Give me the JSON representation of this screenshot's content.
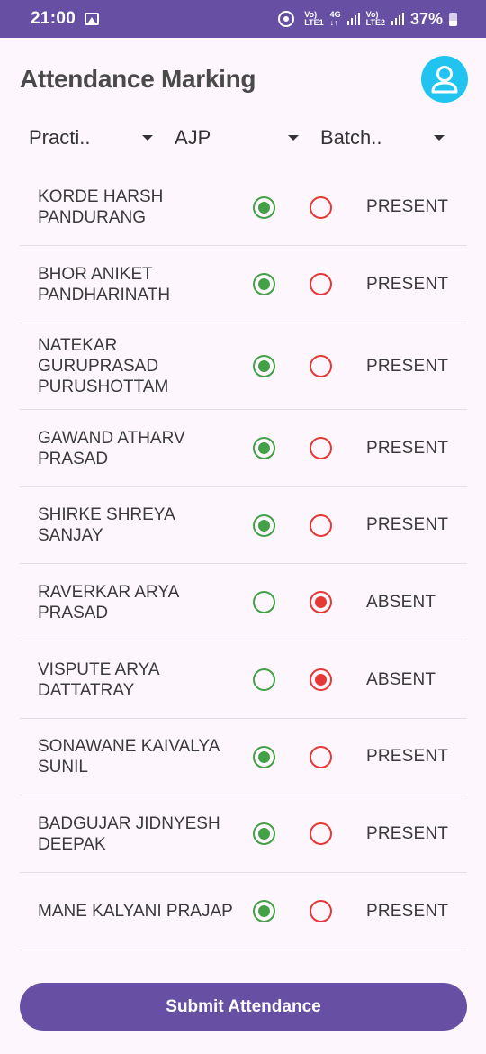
{
  "status_bar": {
    "time": "21:00",
    "network1_top": "Vo)",
    "network1_bottom": "LTE1",
    "network_type": "4G",
    "network2_top": "Vo)",
    "network2_bottom": "LTE2",
    "battery": "37%",
    "icons": [
      "gallery-icon",
      "hotspot-icon",
      "signal-icon",
      "battery-icon"
    ]
  },
  "header": {
    "title": "Attendance Marking",
    "avatar_icon": "user-avatar-icon",
    "avatar_color": "#21c4f0"
  },
  "filters": [
    {
      "value": "Practi.."
    },
    {
      "value": "AJP"
    },
    {
      "value": "Batch.."
    }
  ],
  "students": [
    {
      "name": "KORDE HARSH PANDURANG",
      "status": "PRESENT"
    },
    {
      "name": "BHOR ANIKET PANDHARINATH",
      "status": "PRESENT"
    },
    {
      "name": "NATEKAR GURUPRASAD PURUSHOTTAM",
      "status": "PRESENT"
    },
    {
      "name": "GAWAND ATHARV PRASAD",
      "status": "PRESENT"
    },
    {
      "name": "SHIRKE SHREYA SANJAY",
      "status": "PRESENT"
    },
    {
      "name": "RAVERKAR ARYA PRASAD",
      "status": "ABSENT"
    },
    {
      "name": "VISPUTE ARYA DATTATRAY",
      "status": "ABSENT"
    },
    {
      "name": "SONAWANE KAIVALYA SUNIL",
      "status": "PRESENT"
    },
    {
      "name": "BADGUJAR JIDNYESH DEEPAK",
      "status": "PRESENT"
    },
    {
      "name": "MANE KALYANI PRAJAP",
      "status": "PRESENT"
    }
  ],
  "colors": {
    "accent": "#6750a4",
    "present": "#43a047",
    "absent": "#e53935"
  },
  "submit_label": "Submit Attendance"
}
